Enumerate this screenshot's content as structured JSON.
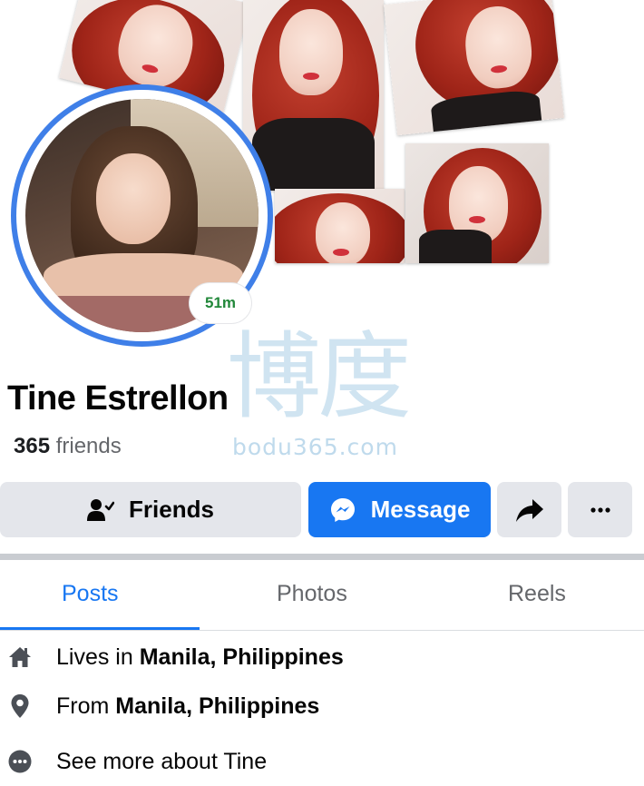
{
  "profile": {
    "name": "Tine Estrellon",
    "friends_count": "365",
    "friends_word": "friends",
    "active_badge": "51m"
  },
  "actions": {
    "friends_label": "Friends",
    "message_label": "Message"
  },
  "tabs": [
    {
      "label": "Posts",
      "active": true
    },
    {
      "label": "Photos",
      "active": false
    },
    {
      "label": "Reels",
      "active": false
    }
  ],
  "intro": {
    "lives_prefix": "Lives in",
    "lives_place": "Manila, Philippines",
    "from_prefix": "From",
    "from_place": "Manila, Philippines",
    "see_more": "See more about Tine"
  },
  "watermark": {
    "glyphs": "博度",
    "text": "bodu365.com"
  },
  "colors": {
    "accent": "#1877f2",
    "active_badge": "#22883a",
    "avatar_ring": "#3f7fe8"
  },
  "icons": [
    "friends-icon",
    "messenger-icon",
    "share-icon",
    "more-icon",
    "home-icon",
    "location-pin-icon",
    "more-dots-icon"
  ]
}
